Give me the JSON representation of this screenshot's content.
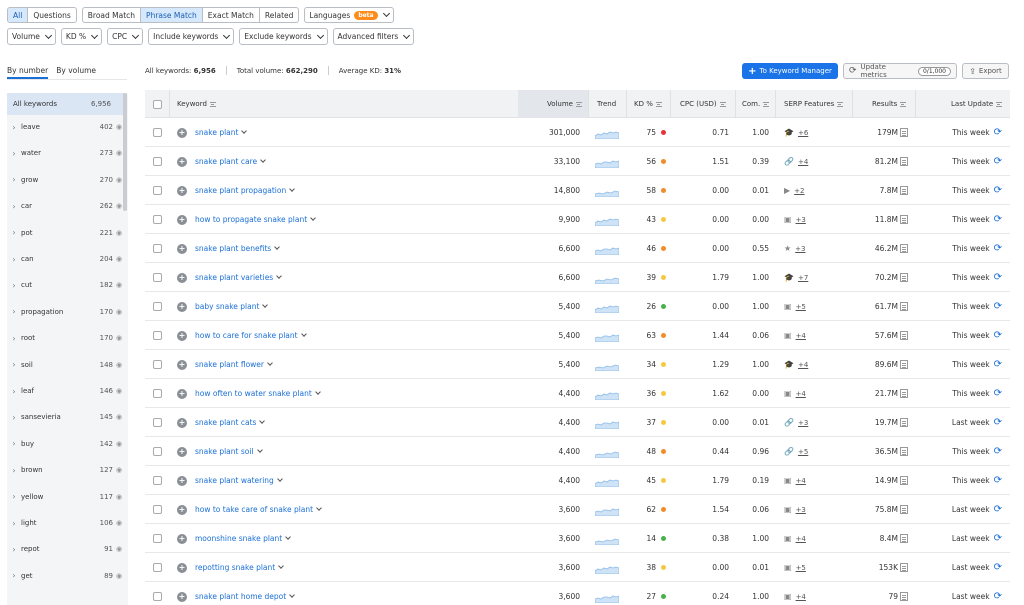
{
  "match_tabs": [
    "All",
    "Questions",
    "Broad Match",
    "Phrase Match",
    "Exact Match",
    "Related"
  ],
  "languages": {
    "label": "Languages",
    "badge": "beta"
  },
  "filters": [
    "Volume",
    "KD %",
    "CPC",
    "Include keywords",
    "Exclude keywords",
    "Advanced filters"
  ],
  "sidebar": {
    "tabs": [
      "By number",
      "By volume"
    ],
    "all": {
      "label": "All keywords",
      "count": "6,956"
    },
    "items": [
      {
        "label": "leave",
        "count": "402"
      },
      {
        "label": "water",
        "count": "273"
      },
      {
        "label": "grow",
        "count": "270"
      },
      {
        "label": "car",
        "count": "262"
      },
      {
        "label": "pot",
        "count": "221"
      },
      {
        "label": "can",
        "count": "204"
      },
      {
        "label": "cut",
        "count": "182"
      },
      {
        "label": "propagation",
        "count": "170"
      },
      {
        "label": "root",
        "count": "170"
      },
      {
        "label": "soil",
        "count": "148"
      },
      {
        "label": "leaf",
        "count": "146"
      },
      {
        "label": "sansevieria",
        "count": "145"
      },
      {
        "label": "buy",
        "count": "142"
      },
      {
        "label": "brown",
        "count": "127"
      },
      {
        "label": "yellow",
        "count": "117"
      },
      {
        "label": "light",
        "count": "106"
      },
      {
        "label": "repot",
        "count": "91"
      },
      {
        "label": "get",
        "count": "89"
      }
    ]
  },
  "summary": {
    "all_keywords_label": "All keywords:",
    "all_keywords": "6,956",
    "total_volume_label": "Total volume:",
    "total_volume": "662,290",
    "avg_kd_label": "Average KD:",
    "avg_kd": "31%"
  },
  "actions": {
    "to_keyword_manager": "To Keyword Manager",
    "update_metrics": "Update metrics",
    "update_count": "0/1,000",
    "export": "Export"
  },
  "columns": [
    "Keyword",
    "Volume",
    "Trend",
    "KD %",
    "CPC (USD)",
    "Com.",
    "SERP Features",
    "Results",
    "Last Update"
  ],
  "colors": {
    "red": "#e8313a",
    "orange": "#f28c28",
    "yellow": "#f5c842",
    "green": "#46b34a",
    "accent": "#1a74e8"
  },
  "rows": [
    {
      "keyword": "snake plant",
      "volume": "301,000",
      "kd": "75",
      "kd_color": "#e8313a",
      "cpc": "0.71",
      "com": "1.00",
      "serp_icon": "graduation-cap-icon",
      "serp_more": "+6",
      "results": "179M",
      "last_update": "This week"
    },
    {
      "keyword": "snake plant care",
      "volume": "33,100",
      "kd": "56",
      "kd_color": "#f28c28",
      "cpc": "1.51",
      "com": "0.39",
      "serp_icon": "link-icon",
      "serp_more": "+4",
      "results": "81.2M",
      "last_update": "This week"
    },
    {
      "keyword": "snake plant propagation",
      "volume": "14,800",
      "kd": "58",
      "kd_color": "#f28c28",
      "cpc": "0.00",
      "com": "0.01",
      "serp_icon": "video-icon",
      "serp_more": "+2",
      "results": "7.8M",
      "last_update": "This week"
    },
    {
      "keyword": "how to propagate snake plant",
      "volume": "9,900",
      "kd": "43",
      "kd_color": "#f5c842",
      "cpc": "0.00",
      "com": "0.00",
      "serp_icon": "image-icon",
      "serp_more": "+3",
      "results": "11.8M",
      "last_update": "This week"
    },
    {
      "keyword": "snake plant benefits",
      "volume": "6,600",
      "kd": "46",
      "kd_color": "#f28c28",
      "cpc": "0.00",
      "com": "0.55",
      "serp_icon": "star-icon",
      "serp_more": "+3",
      "results": "46.2M",
      "last_update": "This week"
    },
    {
      "keyword": "snake plant varieties",
      "volume": "6,600",
      "kd": "39",
      "kd_color": "#f5c842",
      "cpc": "1.79",
      "com": "1.00",
      "serp_icon": "graduation-cap-icon",
      "serp_more": "+7",
      "results": "70.2M",
      "last_update": "This week"
    },
    {
      "keyword": "baby snake plant",
      "volume": "5,400",
      "kd": "26",
      "kd_color": "#46b34a",
      "cpc": "0.00",
      "com": "1.00",
      "serp_icon": "image-icon",
      "serp_more": "+5",
      "results": "61.7M",
      "last_update": "This week"
    },
    {
      "keyword": "how to care for snake plant",
      "volume": "5,400",
      "kd": "63",
      "kd_color": "#f28c28",
      "cpc": "1.44",
      "com": "0.06",
      "serp_icon": "image-icon",
      "serp_more": "+4",
      "results": "57.6M",
      "last_update": "This week"
    },
    {
      "keyword": "snake plant flower",
      "volume": "5,400",
      "kd": "34",
      "kd_color": "#f5c842",
      "cpc": "1.29",
      "com": "1.00",
      "serp_icon": "graduation-cap-icon",
      "serp_more": "+4",
      "results": "89.6M",
      "last_update": "This week"
    },
    {
      "keyword": "how often to water snake plant",
      "volume": "4,400",
      "kd": "36",
      "kd_color": "#f5c842",
      "cpc": "1.62",
      "com": "0.00",
      "serp_icon": "image-icon",
      "serp_more": "+4",
      "results": "21.7M",
      "last_update": "This week"
    },
    {
      "keyword": "snake plant cats",
      "volume": "4,400",
      "kd": "37",
      "kd_color": "#f5c842",
      "cpc": "0.00",
      "com": "0.01",
      "serp_icon": "link-icon",
      "serp_more": "+3",
      "results": "19.7M",
      "last_update": "Last week"
    },
    {
      "keyword": "snake plant soil",
      "volume": "4,400",
      "kd": "48",
      "kd_color": "#f28c28",
      "cpc": "0.44",
      "com": "0.96",
      "serp_icon": "link-icon",
      "serp_more": "+5",
      "results": "36.5M",
      "last_update": "This week"
    },
    {
      "keyword": "snake plant watering",
      "volume": "4,400",
      "kd": "45",
      "kd_color": "#f5c842",
      "cpc": "1.79",
      "com": "0.19",
      "serp_icon": "image-icon",
      "serp_more": "+4",
      "results": "14.9M",
      "last_update": "This week"
    },
    {
      "keyword": "how to take care of snake plant",
      "volume": "3,600",
      "kd": "62",
      "kd_color": "#f28c28",
      "cpc": "1.54",
      "com": "0.06",
      "serp_icon": "image-icon",
      "serp_more": "+3",
      "results": "75.8M",
      "last_update": "Last week"
    },
    {
      "keyword": "moonshine snake plant",
      "volume": "3,600",
      "kd": "14",
      "kd_color": "#46b34a",
      "cpc": "0.38",
      "com": "1.00",
      "serp_icon": "image-icon",
      "serp_more": "+4",
      "results": "8.4M",
      "last_update": "Last week"
    },
    {
      "keyword": "repotting snake plant",
      "volume": "3,600",
      "kd": "38",
      "kd_color": "#f5c842",
      "cpc": "0.00",
      "com": "0.01",
      "serp_icon": "image-icon",
      "serp_more": "+5",
      "results": "153K",
      "last_update": "Last week"
    },
    {
      "keyword": "snake plant home depot",
      "volume": "3,600",
      "kd": "27",
      "kd_color": "#46b34a",
      "cpc": "0.24",
      "com": "1.00",
      "serp_icon": "image-icon",
      "serp_more": "+4",
      "results": "79",
      "last_update": "Last week"
    }
  ]
}
